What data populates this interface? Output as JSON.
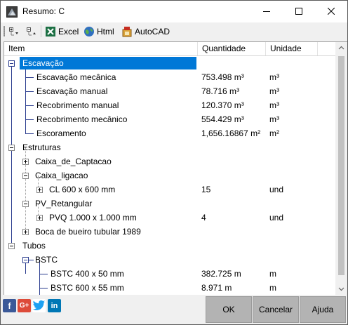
{
  "window": {
    "title": "Resumo: C"
  },
  "toolbar": {
    "excel_label": "Excel",
    "html_label": "Html",
    "autocad_label": "AutoCAD"
  },
  "columns": {
    "item": "Item",
    "quantity": "Quantidade",
    "unit": "Unidade"
  },
  "rows": [
    {
      "label": "Escavação",
      "quantity": "",
      "unit": ""
    },
    {
      "label": "Escavação mecânica",
      "quantity": "753.498 m³",
      "unit": "m³"
    },
    {
      "label": "Escavação manual",
      "quantity": "78.716 m³",
      "unit": "m³"
    },
    {
      "label": "Recobrimento manual",
      "quantity": "120.370 m³",
      "unit": "m³"
    },
    {
      "label": "Recobrimento mecânico",
      "quantity": "554.429 m³",
      "unit": "m³"
    },
    {
      "label": "Escoramento",
      "quantity": "1,656.16867 m²",
      "unit": "m²"
    },
    {
      "label": "Estruturas",
      "quantity": "",
      "unit": ""
    },
    {
      "label": "Caixa_de_Captacao",
      "quantity": "",
      "unit": ""
    },
    {
      "label": "Caixa_ligacao",
      "quantity": "",
      "unit": ""
    },
    {
      "label": "CL 600 x 600 mm",
      "quantity": "15",
      "unit": "und"
    },
    {
      "label": "PV_Retangular",
      "quantity": "",
      "unit": ""
    },
    {
      "label": "PVQ 1.000 x 1.000 mm",
      "quantity": "4",
      "unit": "und"
    },
    {
      "label": "Boca de bueiro tubular 1989",
      "quantity": "",
      "unit": ""
    },
    {
      "label": "Tubos",
      "quantity": "",
      "unit": ""
    },
    {
      "label": "BSTC",
      "quantity": "",
      "unit": ""
    },
    {
      "label": "BSTC 400 x 50 mm",
      "quantity": "382.725 m",
      "unit": "m"
    },
    {
      "label": "BSTC 600 x 55 mm",
      "quantity": "8.971 m",
      "unit": "m"
    }
  ],
  "social": {
    "facebook": "f",
    "googleplus": "G+",
    "linkedin": "in"
  },
  "buttons": {
    "ok": "OK",
    "cancel": "Cancelar",
    "help": "Ajuda"
  },
  "colors": {
    "selection": "#0078d7",
    "tree_lines": "#2b3d8f",
    "button_face": "#b3b3b3",
    "facebook": "#3b5998",
    "googleplus": "#dd4b39",
    "twitter": "#1da1f2",
    "linkedin": "#0077b5"
  }
}
